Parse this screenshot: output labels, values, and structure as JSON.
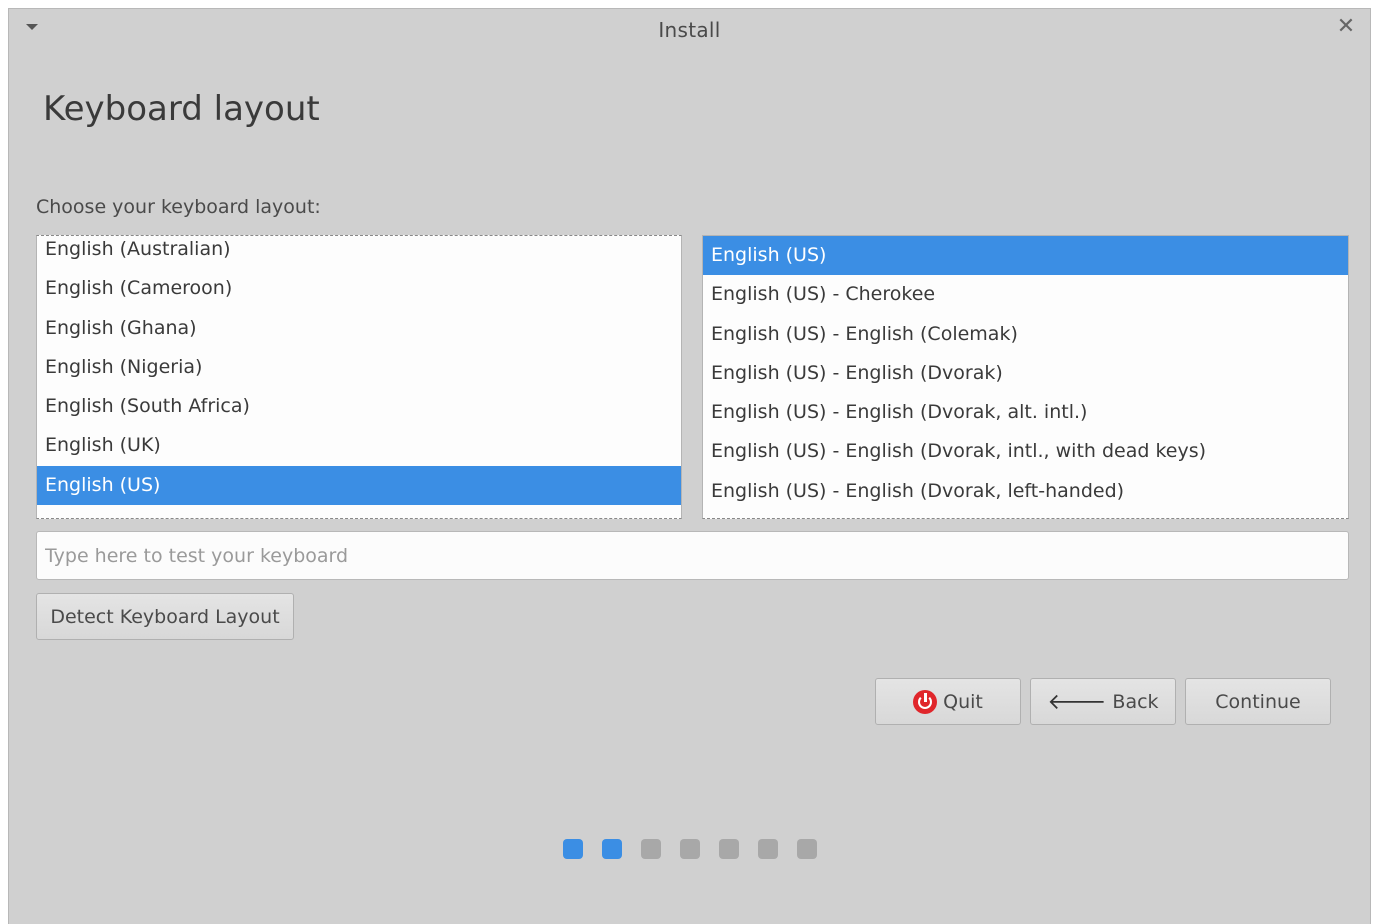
{
  "window": {
    "title": "Install"
  },
  "page": {
    "title": "Keyboard layout",
    "choose_label": "Choose your keyboard layout:"
  },
  "layouts_left": [
    {
      "label": "English (Australian)",
      "selected": false
    },
    {
      "label": "English (Cameroon)",
      "selected": false
    },
    {
      "label": "English (Ghana)",
      "selected": false
    },
    {
      "label": "English (Nigeria)",
      "selected": false
    },
    {
      "label": "English (South Africa)",
      "selected": false
    },
    {
      "label": "English (UK)",
      "selected": false
    },
    {
      "label": "English (US)",
      "selected": true
    }
  ],
  "layouts_right": [
    {
      "label": "English (US)",
      "selected": true
    },
    {
      "label": "English (US) - Cherokee",
      "selected": false
    },
    {
      "label": "English (US) - English (Colemak)",
      "selected": false
    },
    {
      "label": "English (US) - English (Dvorak)",
      "selected": false
    },
    {
      "label": "English (US) - English (Dvorak, alt. intl.)",
      "selected": false
    },
    {
      "label": "English (US) - English (Dvorak, intl., with dead keys)",
      "selected": false
    },
    {
      "label": "English (US) - English (Dvorak, left-handed)",
      "selected": false
    }
  ],
  "test_input": {
    "placeholder": "Type here to test your keyboard",
    "value": ""
  },
  "buttons": {
    "detect": "Detect Keyboard Layout",
    "quit": "Quit",
    "back": "Back",
    "continue": "Continue"
  },
  "icons": {
    "quit": "power-icon",
    "back": "arrow-left-icon",
    "menu": "chevron-down-icon",
    "close": "close-icon"
  },
  "colors": {
    "accent": "#3b8ee4",
    "quit_icon": "#e0262b",
    "window_bg": "#d0d0d0"
  },
  "progress": {
    "total_steps": 7,
    "current_step": 2
  }
}
